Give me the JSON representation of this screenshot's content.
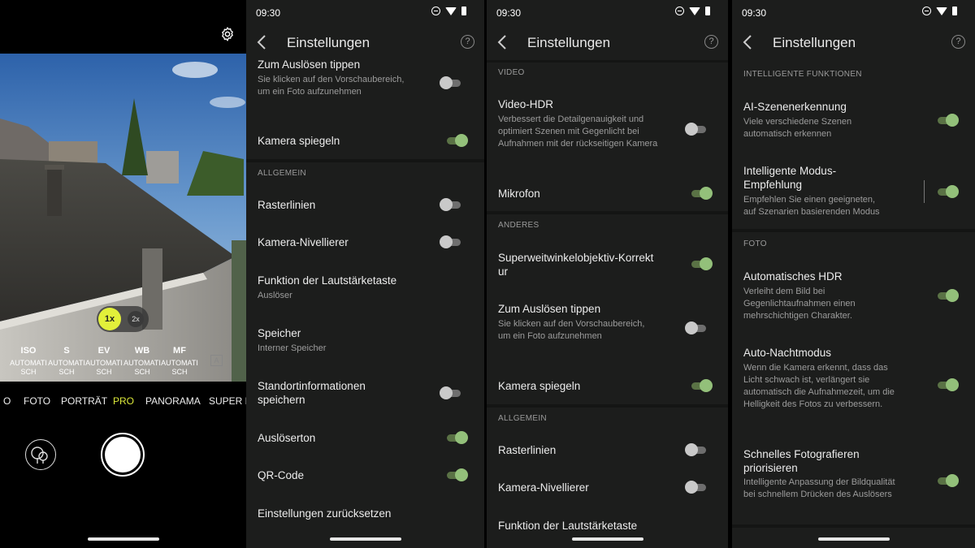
{
  "camera": {
    "pro_settings": [
      {
        "label": "ISO",
        "value1": "AUTOMATI",
        "value2": "SCH"
      },
      {
        "label": "S",
        "value1": "AUTOMATI",
        "value2": "SCH"
      },
      {
        "label": "EV",
        "value1": "AUTOMATI",
        "value2": "SCH"
      },
      {
        "label": "WB",
        "value1": "AUTOMATI",
        "value2": "SCH"
      },
      {
        "label": "MF",
        "value1": "AUTOMATI",
        "value2": "SCH"
      }
    ],
    "auto_box": "A",
    "zoom": [
      "1x",
      "2x"
    ],
    "modes": [
      "O",
      "FOTO",
      "PORTRÄT",
      "PRO",
      "PANORAMA",
      "SUPER N"
    ],
    "active_mode": "PRO"
  },
  "panel1": {
    "time": "09:30",
    "title": "Einstellungen",
    "help": "?",
    "items": [
      {
        "title": "Zum Auslösen tippen",
        "desc": "Sie klicken auf den Vorschaubereich, um ein Foto aufzunehmen",
        "toggle": false
      },
      {
        "title": "Kamera spiegeln",
        "toggle": true
      },
      {
        "section": "ALLGEMEIN"
      },
      {
        "title": "Rasterlinien",
        "toggle": false
      },
      {
        "title": "Kamera-Nivellierer",
        "toggle": false
      },
      {
        "title": "Funktion der Lautstärketaste",
        "desc": "Auslöser"
      },
      {
        "title": "Speicher",
        "desc": "Interner Speicher"
      },
      {
        "title": "Standortinformationen speichern",
        "toggle": false
      },
      {
        "title": "Auslöserton",
        "toggle": true
      },
      {
        "title": "QR-Code",
        "toggle": true
      },
      {
        "title": "Einstellungen zurücksetzen"
      }
    ]
  },
  "panel2": {
    "time": "09:30",
    "title": "Einstellungen",
    "help": "?",
    "items": [
      {
        "section": "VIDEO"
      },
      {
        "title": "Video-HDR",
        "desc": "Verbessert die Detailgenauigkeit und optimiert Szenen mit Gegenlicht bei Aufnahmen mit der rückseitigen Kamera",
        "toggle": false
      },
      {
        "title": "Mikrofon",
        "toggle": true
      },
      {
        "section": "ANDERES"
      },
      {
        "title": "Superweitwinkelobjektiv-Korrektur",
        "toggle": true
      },
      {
        "title": "Zum Auslösen tippen",
        "desc": "Sie klicken auf den Vorschaubereich, um ein Foto aufzunehmen",
        "toggle": false
      },
      {
        "title": "Kamera spiegeln",
        "toggle": true
      },
      {
        "section": "ALLGEMEIN"
      },
      {
        "title": "Rasterlinien",
        "toggle": false
      },
      {
        "title": "Kamera-Nivellierer",
        "toggle": false
      },
      {
        "title": "Funktion der Lautstärketaste"
      }
    ]
  },
  "panel3": {
    "time": "09:30",
    "title": "Einstellungen",
    "help": "?",
    "items": [
      {
        "section": "INTELLIGENTE FUNKTIONEN"
      },
      {
        "title": "AI-Szenenerkennung",
        "desc": "Viele verschiedene Szenen automatisch erkennen",
        "toggle": true
      },
      {
        "title": "Intelligente Modus-Empfehlung",
        "desc": "Empfehlen Sie einen geeigneten, auf Szenarien basierenden Modus",
        "toggle": true
      },
      {
        "section": "FOTO"
      },
      {
        "title": "Automatisches HDR",
        "desc": "Verleiht dem Bild bei Gegenlichtaufnahmen einen mehrschichtigen Charakter.",
        "toggle": true
      },
      {
        "title": "Auto-Nachtmodus",
        "desc": "Wenn die Kamera erkennt, dass das Licht schwach ist, verlängert sie automatisch die Aufnahmezeit, um die Helligkeit des Fotos zu verbessern.",
        "toggle": true
      },
      {
        "title": "Schnelles Fotografieren priorisieren",
        "desc": "Intelligente Anpassung der Bildqualität bei schnellem Drücken des Auslösers",
        "toggle": true
      }
    ]
  },
  "colors": {
    "accent_on": "#93c07a",
    "mode_active": "#dbe83a",
    "zoom_active": "#e2f03a",
    "bg": "#1c1d1c"
  }
}
